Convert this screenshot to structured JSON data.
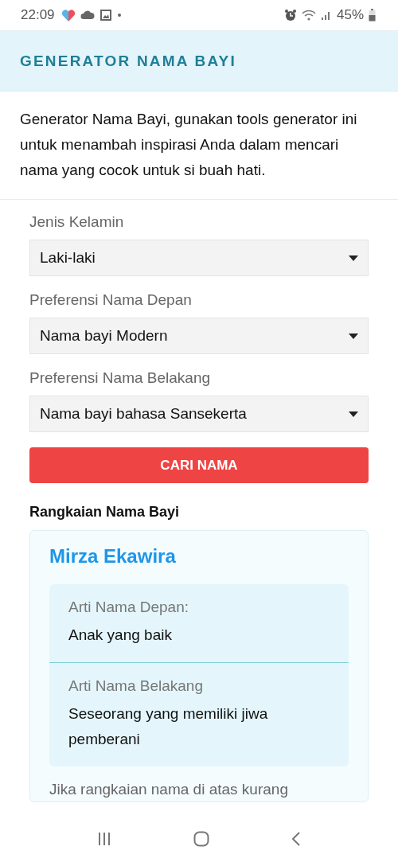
{
  "status_bar": {
    "time": "22:09",
    "battery": "45%"
  },
  "header": {
    "title": "GENERATOR NAMA BAYI"
  },
  "intro": "Generator Nama Bayi, gunakan tools generator ini untuk menambah inspirasi Anda dalam mencari nama yang cocok untuk si buah hati.",
  "form": {
    "fields": [
      {
        "label": "Jenis Kelamin",
        "value": "Laki-laki"
      },
      {
        "label": "Preferensi Nama Depan",
        "value": "Nama bayi Modern"
      },
      {
        "label": "Preferensi Nama Belakang",
        "value": "Nama bayi bahasa Sansekerta"
      }
    ],
    "button": "CARI NAMA"
  },
  "result": {
    "heading": "Rangkaian Nama Bayi",
    "name": "Mirza Ekawira",
    "meanings": [
      {
        "label": "Arti Nama Depan:",
        "text": "Anak yang baik"
      },
      {
        "label": "Arti Nama Belakang",
        "text": "Seseorang yang memiliki jiwa pemberani"
      }
    ],
    "note": "Jika rangkaian nama di atas kurang"
  }
}
